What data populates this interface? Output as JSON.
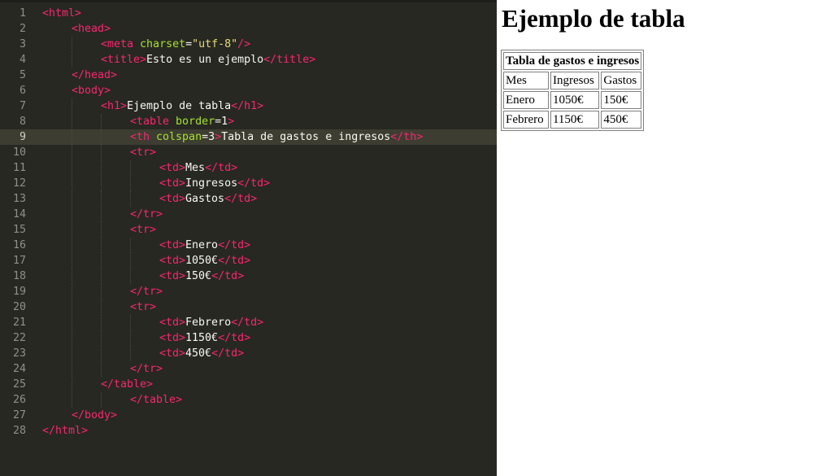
{
  "editor": {
    "lines": [
      {
        "n": "1",
        "indent": 0,
        "tokens": [
          [
            "tag",
            "<html>"
          ]
        ]
      },
      {
        "n": "2",
        "indent": 1,
        "tokens": [
          [
            "tag",
            "<head>"
          ]
        ]
      },
      {
        "n": "3",
        "indent": 2,
        "tokens": [
          [
            "tag",
            "<meta "
          ],
          [
            "attr",
            "charset"
          ],
          [
            "txt",
            "="
          ],
          [
            "str",
            "\"utf-8\""
          ],
          [
            "tag",
            "/>"
          ]
        ]
      },
      {
        "n": "4",
        "indent": 2,
        "tokens": [
          [
            "tag",
            "<title>"
          ],
          [
            "txt",
            "Esto es un ejemplo"
          ],
          [
            "tag",
            "</title>"
          ]
        ]
      },
      {
        "n": "5",
        "indent": 1,
        "tokens": [
          [
            "tag",
            "</head>"
          ]
        ]
      },
      {
        "n": "6",
        "indent": 1,
        "tokens": [
          [
            "tag",
            "<body>"
          ]
        ]
      },
      {
        "n": "7",
        "indent": 2,
        "tokens": [
          [
            "tag",
            "<h1>"
          ],
          [
            "txt",
            "Ejemplo de tabla"
          ],
          [
            "tag",
            "</h1>"
          ]
        ]
      },
      {
        "n": "8",
        "indent": 3,
        "tokens": [
          [
            "tag",
            "<table "
          ],
          [
            "attr",
            "border"
          ],
          [
            "txt",
            "=1"
          ],
          [
            "tag",
            ">"
          ]
        ]
      },
      {
        "n": "9",
        "indent": 3,
        "current": true,
        "tokens": [
          [
            "tag",
            "<th "
          ],
          [
            "attr",
            "colspan"
          ],
          [
            "txt",
            "=3"
          ],
          [
            "tag",
            ">"
          ],
          [
            "txt",
            "Tabla de gastos e ingresos"
          ],
          [
            "tag",
            "</th>"
          ]
        ]
      },
      {
        "n": "10",
        "indent": 3,
        "tokens": [
          [
            "tag",
            "<tr>"
          ]
        ]
      },
      {
        "n": "11",
        "indent": 4,
        "tokens": [
          [
            "tag",
            "<td>"
          ],
          [
            "txt",
            "Mes"
          ],
          [
            "tag",
            "</td>"
          ]
        ]
      },
      {
        "n": "12",
        "indent": 4,
        "tokens": [
          [
            "tag",
            "<td>"
          ],
          [
            "txt",
            "Ingresos"
          ],
          [
            "tag",
            "</td>"
          ]
        ]
      },
      {
        "n": "13",
        "indent": 4,
        "tokens": [
          [
            "tag",
            "<td>"
          ],
          [
            "txt",
            "Gastos"
          ],
          [
            "tag",
            "</td>"
          ]
        ]
      },
      {
        "n": "14",
        "indent": 3,
        "tokens": [
          [
            "tag",
            "</tr>"
          ]
        ]
      },
      {
        "n": "15",
        "indent": 3,
        "tokens": [
          [
            "tag",
            "<tr>"
          ]
        ]
      },
      {
        "n": "16",
        "indent": 4,
        "tokens": [
          [
            "tag",
            "<td>"
          ],
          [
            "txt",
            "Enero"
          ],
          [
            "tag",
            "</td>"
          ]
        ]
      },
      {
        "n": "17",
        "indent": 4,
        "tokens": [
          [
            "tag",
            "<td>"
          ],
          [
            "txt",
            "1050€"
          ],
          [
            "tag",
            "</td>"
          ]
        ]
      },
      {
        "n": "18",
        "indent": 4,
        "tokens": [
          [
            "tag",
            "<td>"
          ],
          [
            "txt",
            "150€"
          ],
          [
            "tag",
            "</td>"
          ]
        ]
      },
      {
        "n": "19",
        "indent": 3,
        "tokens": [
          [
            "tag",
            "</tr>"
          ]
        ]
      },
      {
        "n": "20",
        "indent": 3,
        "tokens": [
          [
            "tag",
            "<tr>"
          ]
        ]
      },
      {
        "n": "21",
        "indent": 4,
        "tokens": [
          [
            "tag",
            "<td>"
          ],
          [
            "txt",
            "Febrero"
          ],
          [
            "tag",
            "</td>"
          ]
        ]
      },
      {
        "n": "22",
        "indent": 4,
        "tokens": [
          [
            "tag",
            "<td>"
          ],
          [
            "txt",
            "1150€"
          ],
          [
            "tag",
            "</td>"
          ]
        ]
      },
      {
        "n": "23",
        "indent": 4,
        "tokens": [
          [
            "tag",
            "<td>"
          ],
          [
            "txt",
            "450€"
          ],
          [
            "tag",
            "</td>"
          ]
        ]
      },
      {
        "n": "24",
        "indent": 3,
        "tokens": [
          [
            "tag",
            "</tr>"
          ]
        ]
      },
      {
        "n": "25",
        "indent": 2,
        "tokens": [
          [
            "tag",
            "</table>"
          ]
        ]
      },
      {
        "n": "26",
        "indent": 3,
        "tokens": [
          [
            "tag",
            "</table>"
          ]
        ]
      },
      {
        "n": "27",
        "indent": 1,
        "tokens": [
          [
            "tag",
            "</body>"
          ]
        ]
      },
      {
        "n": "28",
        "indent": 0,
        "tokens": [
          [
            "tag",
            "</html>"
          ]
        ]
      }
    ],
    "colors": {
      "background": "#272822",
      "tag": "#f92672",
      "attribute": "#a6e22e",
      "string": "#e6db74",
      "text": "#f8f8f2",
      "gutter": "#8f908a",
      "current_line": "#3e3d32"
    }
  },
  "preview": {
    "heading": "Ejemplo de tabla",
    "table": {
      "caption_header": "Tabla de gastos e ingresos",
      "rows": [
        [
          "Mes",
          "Ingresos",
          "Gastos"
        ],
        [
          "Enero",
          "1050€",
          "150€"
        ],
        [
          "Febrero",
          "1150€",
          "450€"
        ]
      ]
    }
  }
}
